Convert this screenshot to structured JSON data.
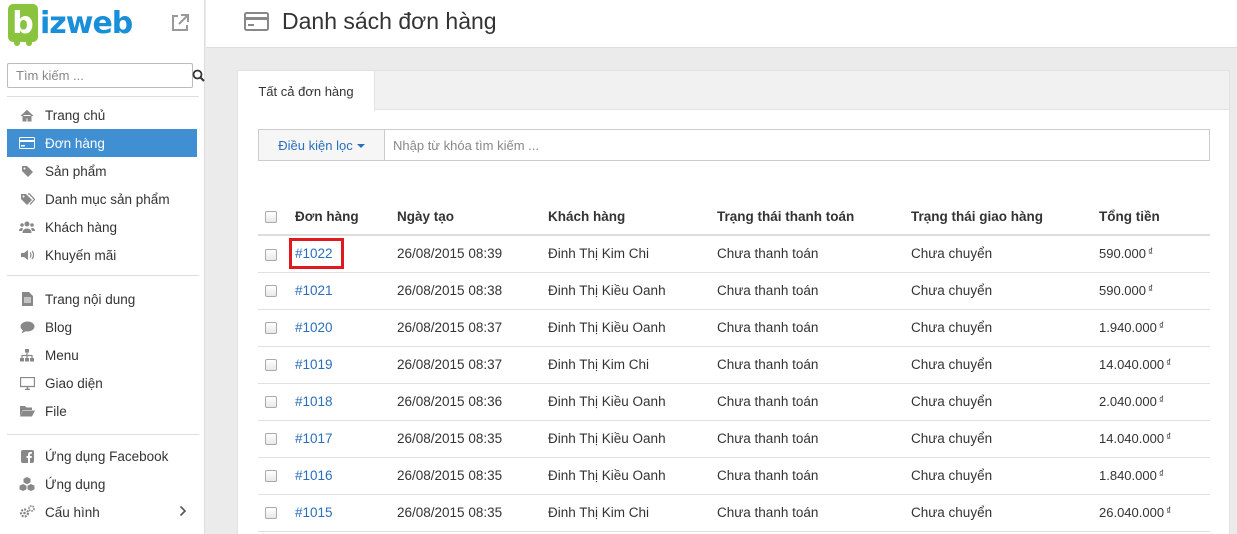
{
  "logo": {
    "letter": "b",
    "text": "izweb"
  },
  "search": {
    "placeholder": "Tìm kiếm ..."
  },
  "nav_groups": [
    [
      {
        "label": "Trang chủ",
        "icon": "home-icon"
      },
      {
        "label": "Đơn hàng",
        "icon": "credit-card-icon",
        "active": true
      },
      {
        "label": "Sản phẩm",
        "icon": "tag-icon"
      },
      {
        "label": "Danh mục sản phẩm",
        "icon": "tags-icon"
      },
      {
        "label": "Khách hàng",
        "icon": "users-icon"
      },
      {
        "label": "Khuyến mãi",
        "icon": "volume-icon"
      }
    ],
    [
      {
        "label": "Trang nội dung",
        "icon": "file-text-icon"
      },
      {
        "label": "Blog",
        "icon": "comment-icon"
      },
      {
        "label": "Menu",
        "icon": "sitemap-icon"
      },
      {
        "label": "Giao diện",
        "icon": "desktop-icon"
      },
      {
        "label": "File",
        "icon": "folder-open-icon"
      }
    ],
    [
      {
        "label": "Ứng dụng Facebook",
        "icon": "facebook-icon"
      },
      {
        "label": "Ứng dụng",
        "icon": "cubes-icon"
      },
      {
        "label": "Cấu hình",
        "icon": "cogs-icon"
      }
    ]
  ],
  "header": {
    "title": "Danh sách đơn hàng"
  },
  "tabs": [
    {
      "label": "Tất cả đơn hàng"
    }
  ],
  "filter": {
    "button_label": "Điều kiện lọc",
    "placeholder": "Nhập từ khóa tìm kiếm ..."
  },
  "table": {
    "columns": [
      "Đơn hàng",
      "Ngày tạo",
      "Khách hàng",
      "Trạng thái thanh toán",
      "Trạng thái giao hàng",
      "Tổng tiền"
    ],
    "currency": "₫",
    "rows": [
      {
        "id": "#1022",
        "date": "26/08/2015 08:39",
        "customer": "Đinh Thị Kim Chi",
        "payment": "Chưa thanh toán",
        "shipping": "Chưa chuyển",
        "total": "590.000",
        "highlighted": true
      },
      {
        "id": "#1021",
        "date": "26/08/2015 08:38",
        "customer": "Đinh Thị Kiều Oanh",
        "payment": "Chưa thanh toán",
        "shipping": "Chưa chuyển",
        "total": "590.000"
      },
      {
        "id": "#1020",
        "date": "26/08/2015 08:37",
        "customer": "Đinh Thị Kiều Oanh",
        "payment": "Chưa thanh toán",
        "shipping": "Chưa chuyển",
        "total": "1.940.000"
      },
      {
        "id": "#1019",
        "date": "26/08/2015 08:37",
        "customer": "Đinh Thị Kim Chi",
        "payment": "Chưa thanh toán",
        "shipping": "Chưa chuyển",
        "total": "14.040.000"
      },
      {
        "id": "#1018",
        "date": "26/08/2015 08:36",
        "customer": "Đinh Thị Kiều Oanh",
        "payment": "Chưa thanh toán",
        "shipping": "Chưa chuyển",
        "total": "2.040.000"
      },
      {
        "id": "#1017",
        "date": "26/08/2015 08:35",
        "customer": "Đinh Thị Kiều Oanh",
        "payment": "Chưa thanh toán",
        "shipping": "Chưa chuyển",
        "total": "14.040.000"
      },
      {
        "id": "#1016",
        "date": "26/08/2015 08:35",
        "customer": "Đinh Thị Kiều Oanh",
        "payment": "Chưa thanh toán",
        "shipping": "Chưa chuyển",
        "total": "1.840.000"
      },
      {
        "id": "#1015",
        "date": "26/08/2015 08:35",
        "customer": "Đinh Thị Kim Chi",
        "payment": "Chưa thanh toán",
        "shipping": "Chưa chuyển",
        "total": "26.040.000"
      }
    ]
  },
  "colors": {
    "accent": "#3f8fd2",
    "link": "#2a6ebb",
    "logo_green": "#8ac43f",
    "logo_blue": "#1a8fd9",
    "highlight": "#e0191f"
  }
}
